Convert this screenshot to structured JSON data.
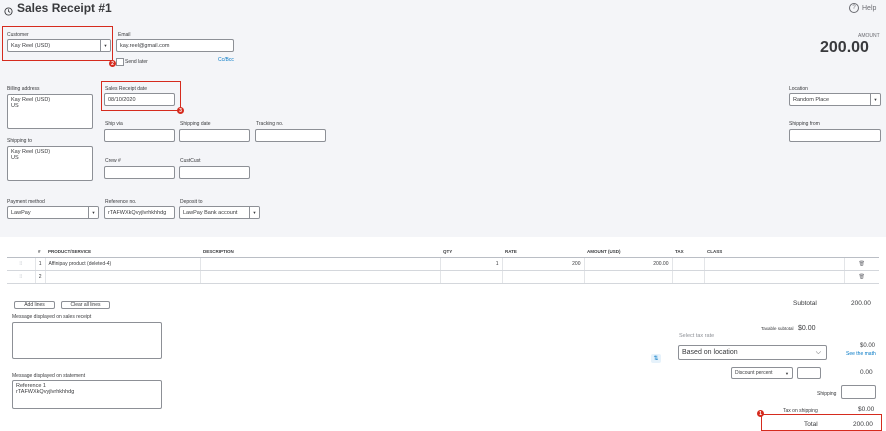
{
  "header": {
    "title": "Sales Receipt #1",
    "help_label": "Help"
  },
  "customer": {
    "label": "Customer",
    "value": "Kay Reel (USD)"
  },
  "email": {
    "label": "Email",
    "value": "kay.reel@gmail.com",
    "send_later": "Send later",
    "cc_bcc": "Cc/Bcc"
  },
  "amount": {
    "label": "AMOUNT",
    "value": "200.00"
  },
  "billing": {
    "label": "Billing address",
    "line1": "Kay Reel (USD)",
    "line2": "US"
  },
  "receipt_date": {
    "label": "Sales Receipt date",
    "value": "08/10/2020"
  },
  "ship_via": {
    "label": "Ship via"
  },
  "shipping_date": {
    "label": "Shipping date"
  },
  "tracking": {
    "label": "Tracking no."
  },
  "shipping_to": {
    "label": "Shipping to",
    "line1": "Kay Reel (USD)",
    "line2": "US"
  },
  "crew": {
    "label": "Crew #"
  },
  "custcust": {
    "label": "CustCust"
  },
  "location": {
    "label": "Location",
    "value": "Random Place"
  },
  "shipping_from": {
    "label": "Shipping from"
  },
  "payment": {
    "label": "Payment method",
    "value": "LawPay"
  },
  "reference": {
    "label": "Reference no.",
    "value": "rTAFWXkQvyjlvrhkhhdg"
  },
  "deposit": {
    "label": "Deposit to",
    "value": "LawPay Bank account"
  },
  "table": {
    "headers": [
      "#",
      "PRODUCT/SERVICE",
      "DESCRIPTION",
      "QTY",
      "RATE",
      "AMOUNT (USD)",
      "TAX",
      "CLASS"
    ],
    "rows": [
      {
        "num": "1",
        "product": "Affinipay product (deleted-4)",
        "description": "",
        "qty": "1",
        "rate": "200",
        "amount": "200.00"
      },
      {
        "num": "2",
        "product": "",
        "description": "",
        "qty": "",
        "rate": "",
        "amount": ""
      }
    ]
  },
  "buttons": {
    "add_lines": "Add lines",
    "clear_lines": "Clear all lines"
  },
  "message_receipt": {
    "label": "Message displayed on sales receipt"
  },
  "message_statement": {
    "label": "Message displayed on statement",
    "line1": "Reference 1",
    "line2": "rTAFWXkQvyjlvrhkhhdg"
  },
  "totals": {
    "subtotal_label": "Subtotal",
    "subtotal_value": "200.00",
    "taxable_label": "Taxable subtotal",
    "taxable_value": "$0.00",
    "select_tax_rate": "Select tax rate",
    "tax_rate_value": "Based on location",
    "tax_value": "$0.00",
    "see_math": "See the math",
    "discount_label": "Discount percent",
    "discount_value": "0.00",
    "shipping_label": "Shipping",
    "tax_on_shipping_label": "Tax on shipping",
    "tax_on_shipping_value": "$0.00",
    "total_label": "Total",
    "total_value": "200.00"
  },
  "badges": {
    "b1": "1",
    "b2": "2",
    "b3": "3"
  },
  "colors": {
    "accent_red": "#d52b1e",
    "link_blue": "#0077c5",
    "form_bg": "#f4f5f8"
  }
}
